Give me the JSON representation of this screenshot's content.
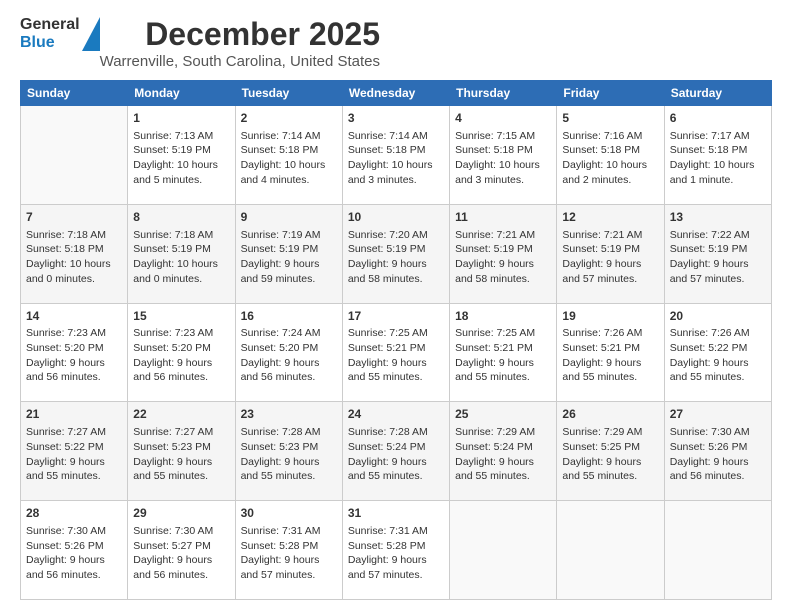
{
  "header": {
    "logo_general": "General",
    "logo_blue": "Blue",
    "month": "December 2025",
    "location": "Warrenville, South Carolina, United States"
  },
  "days_of_week": [
    "Sunday",
    "Monday",
    "Tuesday",
    "Wednesday",
    "Thursday",
    "Friday",
    "Saturday"
  ],
  "weeks": [
    [
      {
        "day": "",
        "info": ""
      },
      {
        "day": "1",
        "info": "Sunrise: 7:13 AM\nSunset: 5:19 PM\nDaylight: 10 hours\nand 5 minutes."
      },
      {
        "day": "2",
        "info": "Sunrise: 7:14 AM\nSunset: 5:18 PM\nDaylight: 10 hours\nand 4 minutes."
      },
      {
        "day": "3",
        "info": "Sunrise: 7:14 AM\nSunset: 5:18 PM\nDaylight: 10 hours\nand 3 minutes."
      },
      {
        "day": "4",
        "info": "Sunrise: 7:15 AM\nSunset: 5:18 PM\nDaylight: 10 hours\nand 3 minutes."
      },
      {
        "day": "5",
        "info": "Sunrise: 7:16 AM\nSunset: 5:18 PM\nDaylight: 10 hours\nand 2 minutes."
      },
      {
        "day": "6",
        "info": "Sunrise: 7:17 AM\nSunset: 5:18 PM\nDaylight: 10 hours\nand 1 minute."
      }
    ],
    [
      {
        "day": "7",
        "info": "Sunrise: 7:18 AM\nSunset: 5:18 PM\nDaylight: 10 hours\nand 0 minutes."
      },
      {
        "day": "8",
        "info": "Sunrise: 7:18 AM\nSunset: 5:19 PM\nDaylight: 10 hours\nand 0 minutes."
      },
      {
        "day": "9",
        "info": "Sunrise: 7:19 AM\nSunset: 5:19 PM\nDaylight: 9 hours\nand 59 minutes."
      },
      {
        "day": "10",
        "info": "Sunrise: 7:20 AM\nSunset: 5:19 PM\nDaylight: 9 hours\nand 58 minutes."
      },
      {
        "day": "11",
        "info": "Sunrise: 7:21 AM\nSunset: 5:19 PM\nDaylight: 9 hours\nand 58 minutes."
      },
      {
        "day": "12",
        "info": "Sunrise: 7:21 AM\nSunset: 5:19 PM\nDaylight: 9 hours\nand 57 minutes."
      },
      {
        "day": "13",
        "info": "Sunrise: 7:22 AM\nSunset: 5:19 PM\nDaylight: 9 hours\nand 57 minutes."
      }
    ],
    [
      {
        "day": "14",
        "info": "Sunrise: 7:23 AM\nSunset: 5:20 PM\nDaylight: 9 hours\nand 56 minutes."
      },
      {
        "day": "15",
        "info": "Sunrise: 7:23 AM\nSunset: 5:20 PM\nDaylight: 9 hours\nand 56 minutes."
      },
      {
        "day": "16",
        "info": "Sunrise: 7:24 AM\nSunset: 5:20 PM\nDaylight: 9 hours\nand 56 minutes."
      },
      {
        "day": "17",
        "info": "Sunrise: 7:25 AM\nSunset: 5:21 PM\nDaylight: 9 hours\nand 55 minutes."
      },
      {
        "day": "18",
        "info": "Sunrise: 7:25 AM\nSunset: 5:21 PM\nDaylight: 9 hours\nand 55 minutes."
      },
      {
        "day": "19",
        "info": "Sunrise: 7:26 AM\nSunset: 5:21 PM\nDaylight: 9 hours\nand 55 minutes."
      },
      {
        "day": "20",
        "info": "Sunrise: 7:26 AM\nSunset: 5:22 PM\nDaylight: 9 hours\nand 55 minutes."
      }
    ],
    [
      {
        "day": "21",
        "info": "Sunrise: 7:27 AM\nSunset: 5:22 PM\nDaylight: 9 hours\nand 55 minutes."
      },
      {
        "day": "22",
        "info": "Sunrise: 7:27 AM\nSunset: 5:23 PM\nDaylight: 9 hours\nand 55 minutes."
      },
      {
        "day": "23",
        "info": "Sunrise: 7:28 AM\nSunset: 5:23 PM\nDaylight: 9 hours\nand 55 minutes."
      },
      {
        "day": "24",
        "info": "Sunrise: 7:28 AM\nSunset: 5:24 PM\nDaylight: 9 hours\nand 55 minutes."
      },
      {
        "day": "25",
        "info": "Sunrise: 7:29 AM\nSunset: 5:24 PM\nDaylight: 9 hours\nand 55 minutes."
      },
      {
        "day": "26",
        "info": "Sunrise: 7:29 AM\nSunset: 5:25 PM\nDaylight: 9 hours\nand 55 minutes."
      },
      {
        "day": "27",
        "info": "Sunrise: 7:30 AM\nSunset: 5:26 PM\nDaylight: 9 hours\nand 56 minutes."
      }
    ],
    [
      {
        "day": "28",
        "info": "Sunrise: 7:30 AM\nSunset: 5:26 PM\nDaylight: 9 hours\nand 56 minutes."
      },
      {
        "day": "29",
        "info": "Sunrise: 7:30 AM\nSunset: 5:27 PM\nDaylight: 9 hours\nand 56 minutes."
      },
      {
        "day": "30",
        "info": "Sunrise: 7:31 AM\nSunset: 5:28 PM\nDaylight: 9 hours\nand 57 minutes."
      },
      {
        "day": "31",
        "info": "Sunrise: 7:31 AM\nSunset: 5:28 PM\nDaylight: 9 hours\nand 57 minutes."
      },
      {
        "day": "",
        "info": ""
      },
      {
        "day": "",
        "info": ""
      },
      {
        "day": "",
        "info": ""
      }
    ]
  ]
}
